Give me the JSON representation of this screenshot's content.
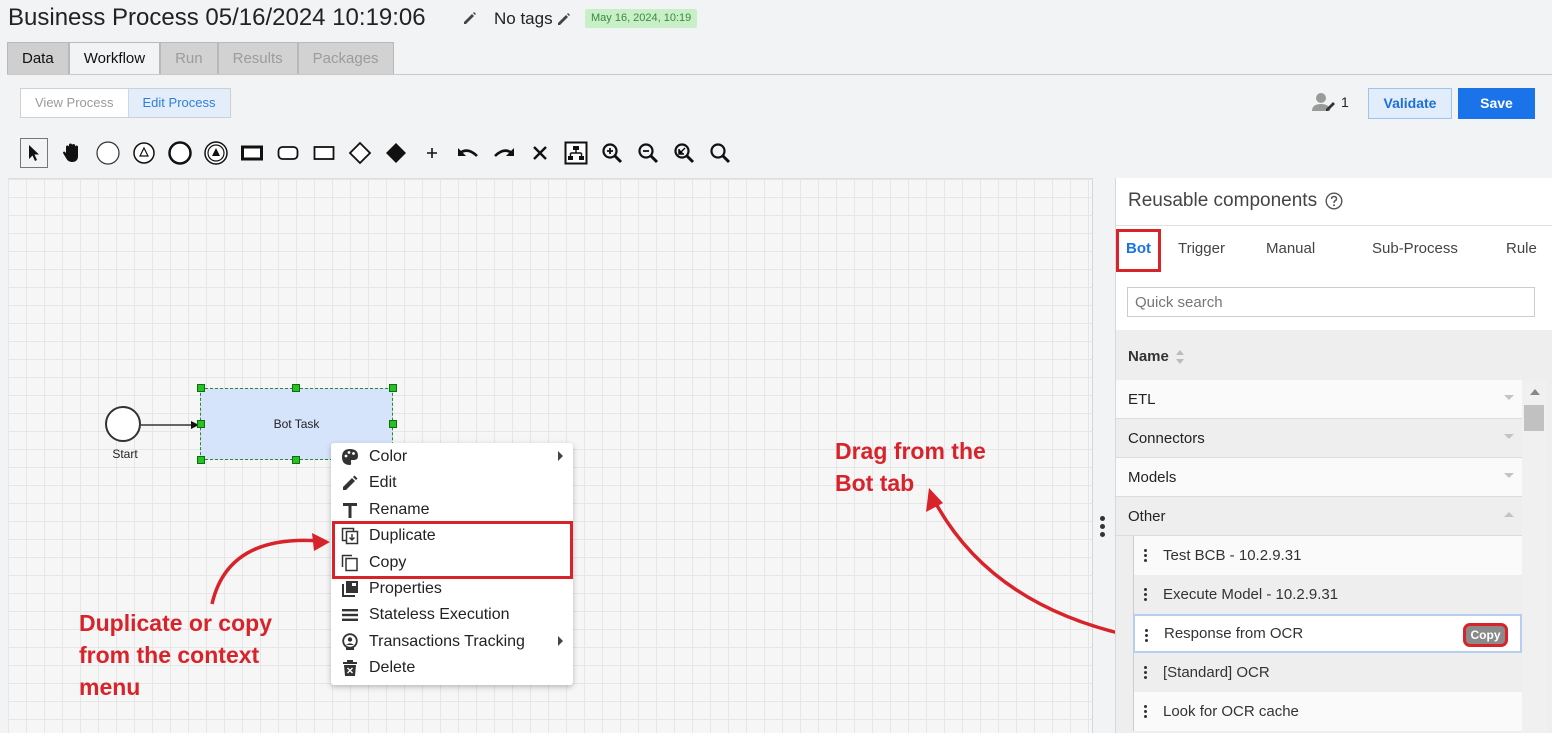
{
  "header": {
    "title": "Business Process 05/16/2024 10:19:06",
    "tags": "No tags",
    "date_badge": "May 16, 2024, 10:19"
  },
  "tabs": [
    "Data",
    "Workflow",
    "Run",
    "Results",
    "Packages"
  ],
  "toolbar": {
    "view_process": "View Process",
    "edit_process": "Edit Process",
    "user_count": "1",
    "validate": "Validate",
    "save": "Save"
  },
  "tools": [
    "pointer",
    "hand",
    "start-event",
    "trigger-event",
    "end-event",
    "intermediate-event",
    "task",
    "rounded-task",
    "subprocess",
    "gateway",
    "gateway-filled",
    "add",
    "undo",
    "redo",
    "delete",
    "layout",
    "zoom-in",
    "zoom-out",
    "zoom-fit",
    "zoom-reset"
  ],
  "diagram": {
    "start_label": "Start",
    "task_label": "Bot Task"
  },
  "context_menu": [
    {
      "label": "Color",
      "icon": "palette-icon",
      "submenu": true
    },
    {
      "label": "Edit",
      "icon": "pencil-icon",
      "submenu": false
    },
    {
      "label": "Rename",
      "icon": "text-icon",
      "submenu": false
    },
    {
      "label": "Duplicate",
      "icon": "duplicate-icon",
      "submenu": false
    },
    {
      "label": "Copy",
      "icon": "copy-icon",
      "submenu": false
    },
    {
      "label": "Properties",
      "icon": "properties-icon",
      "submenu": false
    },
    {
      "label": "Stateless Execution",
      "icon": "list-icon",
      "submenu": false
    },
    {
      "label": "Transactions Tracking",
      "icon": "tracking-icon",
      "submenu": true
    },
    {
      "label": "Delete",
      "icon": "trash-icon",
      "submenu": false
    }
  ],
  "annotations": {
    "left_note": [
      "Duplicate or copy",
      "from the context",
      "menu"
    ],
    "right_note": [
      "Drag from the",
      "Bot tab"
    ]
  },
  "panel": {
    "title": "Reusable components",
    "tabs": [
      "Bot",
      "Trigger",
      "Manual",
      "Sub-Process",
      "Rule"
    ],
    "search_placeholder": "Quick search",
    "column_header": "Name",
    "groups": [
      "ETL",
      "Connectors",
      "Models",
      "Other"
    ],
    "items": [
      "Test BCB - 10.2.9.31",
      "Execute Model - 10.2.9.31",
      "Response from OCR",
      "[Standard] OCR",
      "Look for OCR cache"
    ],
    "copy_button": "Copy"
  },
  "colors": {
    "accent": "#1a73e8",
    "annotation": "#d8232a",
    "task_fill": "#d6e4fb",
    "badge": "#c9efc9"
  }
}
